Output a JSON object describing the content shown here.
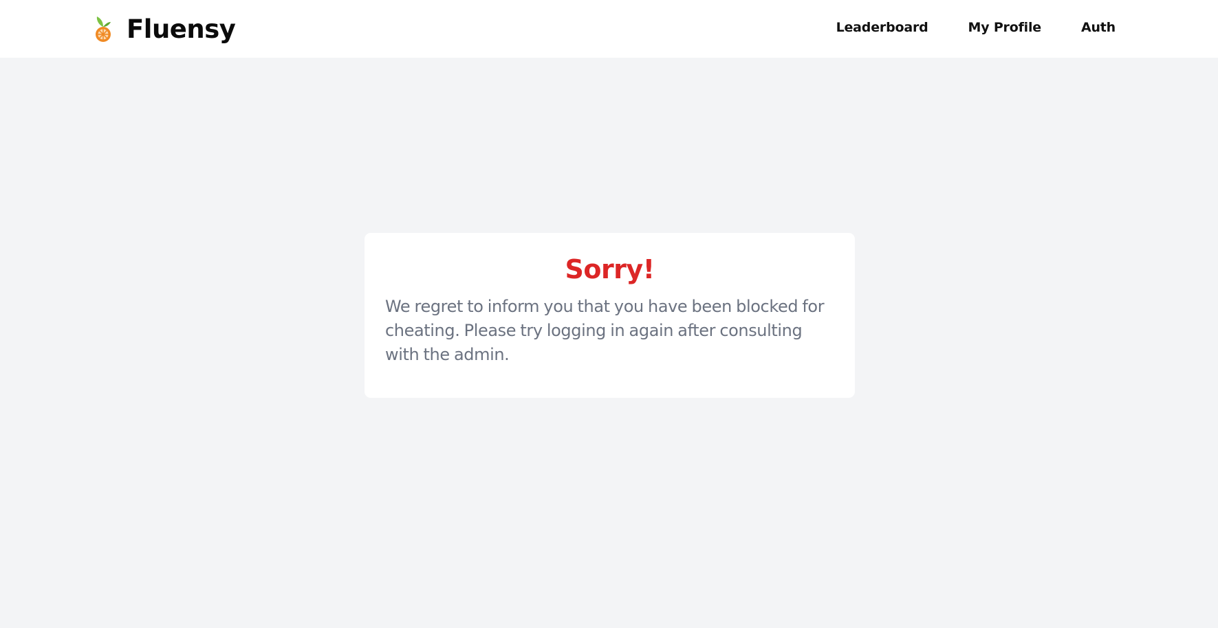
{
  "brand": {
    "name": "Fluensy",
    "logo_icon": "orange-fruit-icon",
    "colors": {
      "leaf": "#7cc243",
      "fruit": "#f08a24"
    }
  },
  "nav": {
    "items": [
      {
        "label": "Leaderboard"
      },
      {
        "label": "My Profile"
      },
      {
        "label": "Auth"
      }
    ]
  },
  "blocked_notice": {
    "title": "Sorry!",
    "message": "We regret to inform you that you have been blocked for cheating. Please try logging in again after consulting with the admin.",
    "title_color": "#dc2626"
  }
}
